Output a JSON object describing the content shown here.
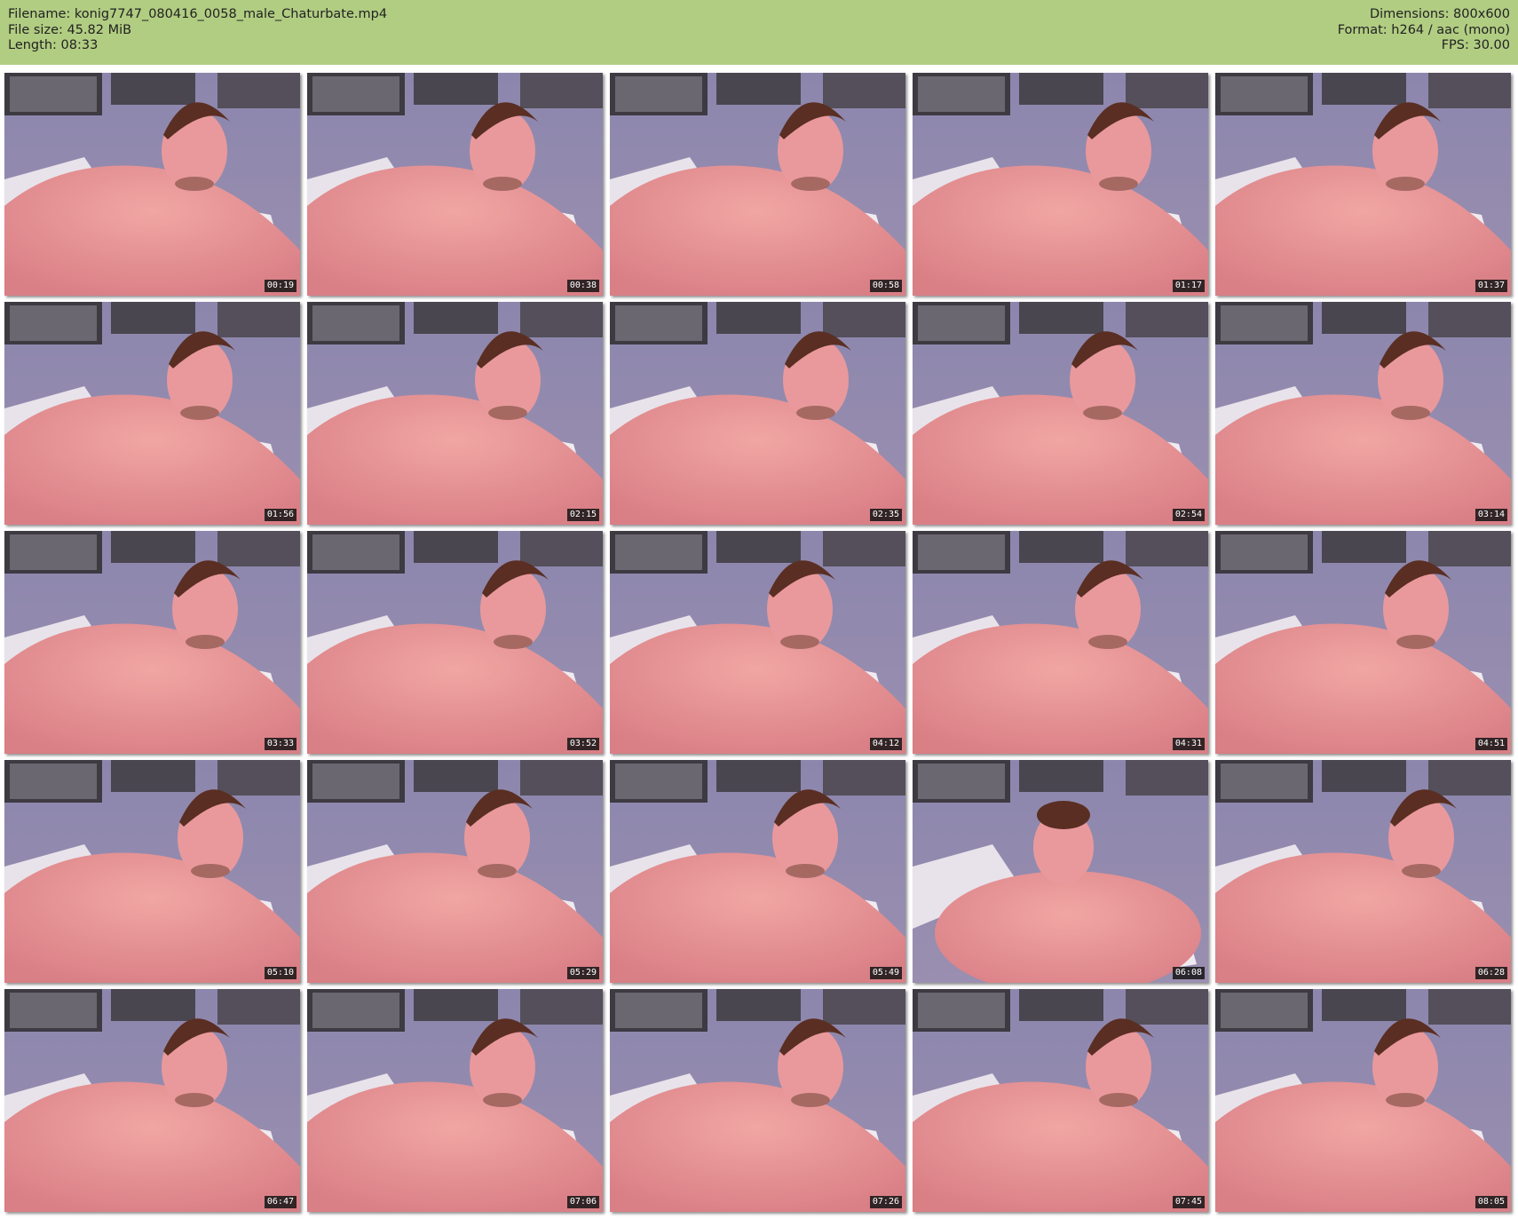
{
  "info": {
    "filename": "Filename: konig7747_080416_0058_male_Chaturbate.mp4",
    "filesize": "File size: 45.82 MiB",
    "length": "Length: 08:33",
    "dimensions": "Dimensions: 800x600",
    "format": "Format: h264 / aac (mono)",
    "fps": "FPS: 30.00"
  },
  "colors": {
    "header_bg": "#b1cd82",
    "page_bg": "#ffffff",
    "timestamp_bg": "#141414"
  },
  "thumbnails": [
    {
      "timestamp": "00:19"
    },
    {
      "timestamp": "00:38"
    },
    {
      "timestamp": "00:58"
    },
    {
      "timestamp": "01:17"
    },
    {
      "timestamp": "01:37"
    },
    {
      "timestamp": "01:56"
    },
    {
      "timestamp": "02:15"
    },
    {
      "timestamp": "02:35"
    },
    {
      "timestamp": "02:54"
    },
    {
      "timestamp": "03:14"
    },
    {
      "timestamp": "03:33"
    },
    {
      "timestamp": "03:52"
    },
    {
      "timestamp": "04:12"
    },
    {
      "timestamp": "04:31"
    },
    {
      "timestamp": "04:51"
    },
    {
      "timestamp": "05:10"
    },
    {
      "timestamp": "05:29"
    },
    {
      "timestamp": "05:49"
    },
    {
      "timestamp": "06:08"
    },
    {
      "timestamp": "06:28"
    },
    {
      "timestamp": "06:47"
    },
    {
      "timestamp": "07:06"
    },
    {
      "timestamp": "07:26"
    },
    {
      "timestamp": "07:45"
    },
    {
      "timestamp": "08:05"
    }
  ]
}
